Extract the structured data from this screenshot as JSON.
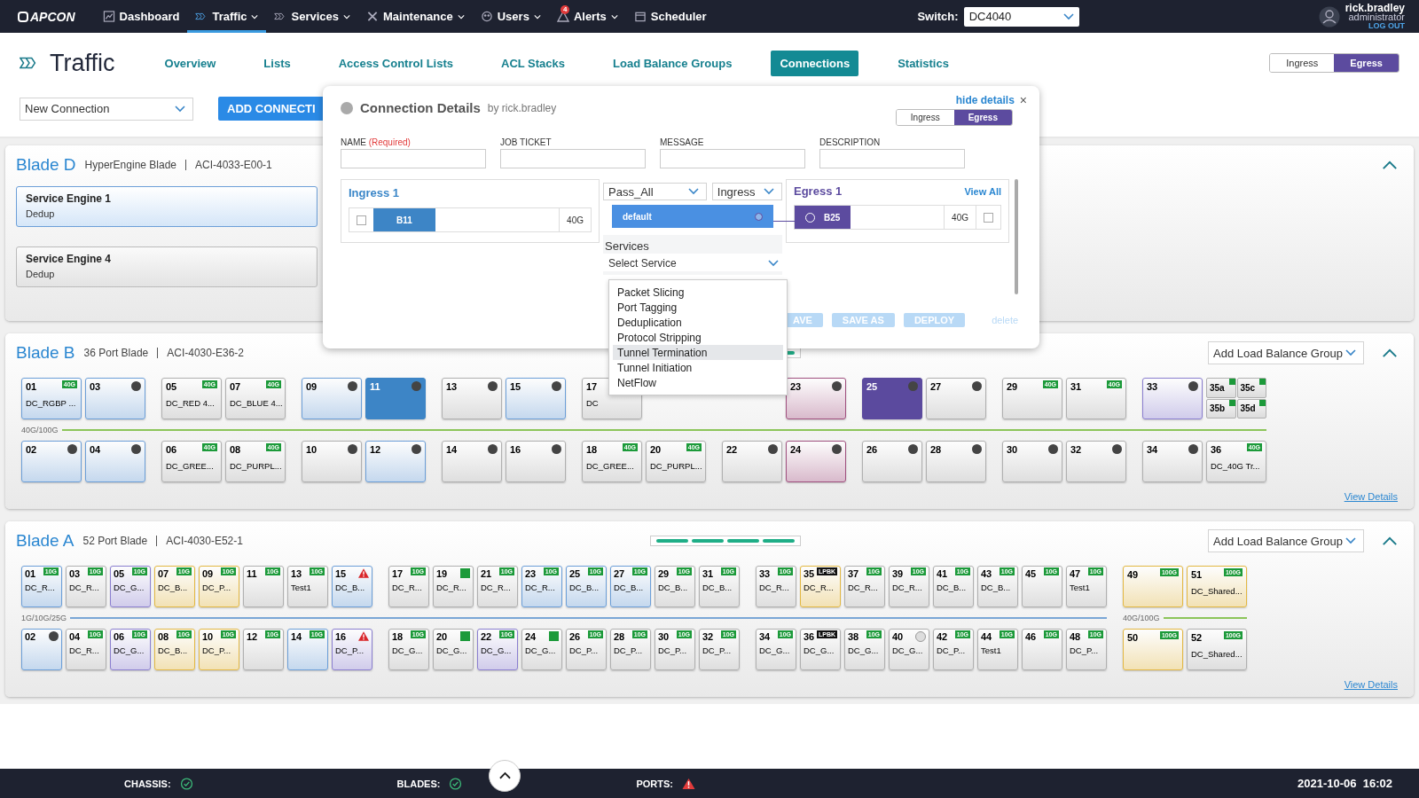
{
  "nav": {
    "logo": "APCON",
    "items": [
      {
        "label": "Dashboard",
        "selected": false,
        "caret": false
      },
      {
        "label": "Traffic",
        "selected": true,
        "caret": true
      },
      {
        "label": "Services",
        "selected": false,
        "caret": true
      },
      {
        "label": "Maintenance",
        "selected": false,
        "caret": true
      },
      {
        "label": "Users",
        "selected": false,
        "caret": true
      },
      {
        "label": "Alerts",
        "selected": false,
        "caret": true,
        "badge": "4"
      },
      {
        "label": "Scheduler",
        "selected": false,
        "caret": false
      }
    ],
    "switch": {
      "label": "Switch:",
      "value": "DC4040"
    },
    "user": {
      "name": "rick.bradley",
      "role": "administrator",
      "logout": "LOG OUT"
    }
  },
  "page": {
    "title": "Traffic",
    "tabs": [
      {
        "label": "Overview",
        "selected": false
      },
      {
        "label": "Lists",
        "selected": false
      },
      {
        "label": "Access Control Lists",
        "selected": false
      },
      {
        "label": "ACL Stacks",
        "selected": false
      },
      {
        "label": "Load Balance Groups",
        "selected": false
      },
      {
        "label": "Connections",
        "selected": true
      },
      {
        "label": "Statistics",
        "selected": false
      }
    ],
    "direction": [
      {
        "label": "Ingress",
        "selected": false
      },
      {
        "label": "Egress",
        "selected": true
      }
    ]
  },
  "toolbar": {
    "connection_select": "New Connection",
    "add_button": "ADD CONNECTI"
  },
  "blades": [
    {
      "kind": "engines",
      "name": "Blade D",
      "type": "HyperEngine Blade",
      "model": "ACI-4033-E00-1",
      "expanded": true,
      "engines": [
        {
          "name": "Service Engine 1",
          "service": "Dedup",
          "selected": true
        },
        {
          "name": "Service Engine 4",
          "service": "Dedup",
          "selected": false
        }
      ]
    },
    {
      "kind": "ports",
      "name": "Blade B",
      "type": "36 Port Blade",
      "model": "ACI-4030-E36-2",
      "expanded": true,
      "lb_select": "Add Load Balance Group",
      "view_details": "View Details",
      "groups": [
        {
          "speed": "40G/100G",
          "color": "#8cc55a",
          "top": [
            {
              "n": "01",
              "label": "DC_RGBP ...",
              "badge": "40G",
              "color": "#6c9fd8"
            },
            {
              "n": "03",
              "indicator": {
                "kind": "dot"
              },
              "color": "#6c9fd8"
            }
          ],
          "bottom": [
            {
              "n": "02",
              "indicator": {
                "kind": "dot"
              },
              "color": "#6c9fd8"
            },
            {
              "n": "04",
              "indicator": {
                "kind": "dot"
              },
              "color": "#6c9fd8"
            }
          ]
        },
        {
          "color": "#8cc55a",
          "top": [
            {
              "n": "05",
              "label": "DC_RED 4...",
              "badge": "40G",
              "color": "#b0b0b0"
            },
            {
              "n": "07",
              "label": "DC_BLUE 4...",
              "badge": "40G",
              "color": "#b0b0b0"
            }
          ],
          "bottom": [
            {
              "n": "06",
              "label": "DC_GREE...",
              "badge": "40G",
              "color": "#b0b0b0"
            },
            {
              "n": "08",
              "label": "DC_PURPL...",
              "badge": "40G",
              "color": "#b0b0b0"
            }
          ]
        },
        {
          "color": "#8cc55a",
          "top": [
            {
              "n": "09",
              "indicator": {
                "kind": "dot"
              },
              "color": "#6c9fd8"
            },
            {
              "n": "11",
              "kind": "filled",
              "indicator": {
                "kind": "dot"
              },
              "color": "#3d85c6"
            }
          ],
          "bottom": [
            {
              "n": "10",
              "indicator": {
                "kind": "dot"
              },
              "color": "#b0b0b0"
            },
            {
              "n": "12",
              "indicator": {
                "kind": "dot"
              },
              "color": "#6c9fd8"
            }
          ]
        },
        {
          "color": "#8cc55a",
          "top": [
            {
              "n": "13",
              "indicator": {
                "kind": "dot"
              },
              "color": "#b0b0b0"
            },
            {
              "n": "15",
              "indicator": {
                "kind": "dot"
              },
              "color": "#6c9fd8"
            }
          ],
          "bottom": [
            {
              "n": "14",
              "indicator": {
                "kind": "dot"
              },
              "color": "#b0b0b0"
            },
            {
              "n": "16",
              "indicator": {
                "kind": "dot"
              },
              "color": "#b0b0b0"
            }
          ]
        },
        {
          "color": "#8cc55a",
          "top": [
            {
              "n": "17",
              "label": "DC",
              "color": "#b0b0b0"
            },
            {
              "kind": "covered"
            }
          ],
          "bottom": [
            {
              "n": "18",
              "label": "DC_GREE...",
              "badge": "40G",
              "color": "#b0b0b0"
            },
            {
              "n": "20",
              "label": "DC_PURPL...",
              "badge": "40G",
              "color": "#b0b0b0"
            }
          ]
        },
        {
          "color": "#8cc55a",
          "top": [
            {
              "kind": "covered"
            },
            {
              "n": "23",
              "indicator": {
                "kind": "dot"
              },
              "color": "#a0507f"
            }
          ],
          "bottom": [
            {
              "n": "22",
              "indicator": {
                "kind": "dot"
              },
              "color": "#b0b0b0"
            },
            {
              "n": "24",
              "indicator": {
                "kind": "dot"
              },
              "color": "#a0507f"
            }
          ]
        },
        {
          "color": "#8cc55a",
          "top": [
            {
              "n": "25",
              "kind": "filled",
              "indicator": {
                "kind": "dot"
              },
              "color": "#5b4a9e"
            },
            {
              "n": "27",
              "indicator": {
                "kind": "dot"
              },
              "color": "#b0b0b0"
            }
          ],
          "bottom": [
            {
              "n": "26",
              "indicator": {
                "kind": "dot"
              },
              "color": "#b0b0b0"
            },
            {
              "n": "28",
              "indicator": {
                "kind": "dot"
              },
              "color": "#b0b0b0"
            }
          ]
        },
        {
          "color": "#8cc55a",
          "top": [
            {
              "n": "29",
              "badge": "40G",
              "color": "#b0b0b0"
            },
            {
              "n": "31",
              "badge": "40G",
              "color": "#b0b0b0"
            }
          ],
          "bottom": [
            {
              "n": "30",
              "indicator": {
                "kind": "dot"
              },
              "color": "#b0b0b0"
            },
            {
              "n": "32",
              "indicator": {
                "kind": "dot"
              },
              "color": "#b0b0b0"
            }
          ]
        },
        {
          "color": "#8cc55a",
          "top": [
            {
              "n": "33",
              "indicator": {
                "kind": "dot"
              },
              "color": "#8b7fd0"
            },
            {
              "kind": "split",
              "subports": [
                {
                  "n": "35a"
                },
                {
                  "n": "35c"
                },
                {
                  "n": "35b"
                },
                {
                  "n": "35d"
                }
              ]
            }
          ],
          "bottom": [
            {
              "n": "34",
              "indicator": {
                "kind": "dot"
              },
              "color": "#b0b0b0"
            },
            {
              "n": "36",
              "label": "DC_40G Tr...",
              "badge": "40G",
              "color": "#b0b0b0"
            }
          ]
        }
      ]
    },
    {
      "kind": "ports",
      "name": "Blade A",
      "type": "52 Port Blade",
      "model": "ACI-4030-E52-1",
      "expanded": true,
      "lb_select": "Add Load Balance Group",
      "view_details": "View Details",
      "groups": [
        {
          "speed": "1G/10G/25G",
          "color": "#7aa6d6",
          "top": [
            {
              "n": "01",
              "label": "DC_R...",
              "badge": "10G",
              "color": "#6c9fd8"
            },
            {
              "n": "03",
              "label": "DC_R...",
              "badge": "10G",
              "color": "#b0b0b0"
            },
            {
              "n": "05",
              "label": "DC_G...",
              "badge": "10G",
              "color": "#8b7fd0"
            },
            {
              "n": "07",
              "label": "DC_B...",
              "badge": "10G",
              "color": "#e3b843"
            },
            {
              "n": "09",
              "label": "DC_P...",
              "badge": "10G",
              "color": "#e3b843"
            },
            {
              "n": "11",
              "badge": "10G",
              "color": "#b0b0b0"
            },
            {
              "n": "13",
              "label": "Test1",
              "badge": "10G",
              "color": "#b0b0b0"
            },
            {
              "n": "15",
              "label": "DC_B...",
              "indicator": {
                "kind": "warning"
              },
              "color": "#6c9fd8"
            }
          ],
          "bottom": [
            {
              "n": "02",
              "indicator": {
                "kind": "dot"
              },
              "color": "#6c9fd8"
            },
            {
              "n": "04",
              "label": "DC_R...",
              "badge": "10G",
              "color": "#b0b0b0"
            },
            {
              "n": "06",
              "label": "DC_G...",
              "badge": "10G",
              "color": "#8b7fd0"
            },
            {
              "n": "08",
              "label": "DC_B...",
              "badge": "10G",
              "color": "#e3b843"
            },
            {
              "n": "10",
              "label": "DC_P...",
              "badge": "10G",
              "color": "#e3b843"
            },
            {
              "n": "12",
              "badge": "10G",
              "color": "#b0b0b0"
            },
            {
              "n": "14",
              "badge": "10G",
              "color": "#6c9fd8"
            },
            {
              "n": "16",
              "label": "DC_P...",
              "indicator": {
                "kind": "warning"
              },
              "color": "#8b7fd0"
            }
          ]
        },
        {
          "color": "#7aa6d6",
          "top": [
            {
              "n": "17",
              "label": "DC_R...",
              "badge": "10G",
              "color": "#b0b0b0"
            },
            {
              "n": "19",
              "label": "DC_R...",
              "indicator": {
                "kind": "square"
              },
              "color": "#b0b0b0"
            },
            {
              "n": "21",
              "label": "DC_R...",
              "badge": "10G",
              "color": "#b0b0b0"
            },
            {
              "n": "23",
              "label": "DC_R...",
              "badge": "10G",
              "color": "#6c9fd8"
            },
            {
              "n": "25",
              "label": "DC_B...",
              "badge": "10G",
              "color": "#6c9fd8"
            },
            {
              "n": "27",
              "label": "DC_B...",
              "badge": "10G",
              "color": "#6c9fd8"
            },
            {
              "n": "29",
              "label": "DC_B...",
              "badge": "10G",
              "color": "#b0b0b0"
            },
            {
              "n": "31",
              "label": "DC_B...",
              "badge": "10G",
              "color": "#b0b0b0"
            }
          ],
          "bottom": [
            {
              "n": "18",
              "label": "DC_G...",
              "badge": "10G",
              "color": "#b0b0b0"
            },
            {
              "n": "20",
              "label": "DC_G...",
              "indicator": {
                "kind": "square"
              },
              "color": "#b0b0b0"
            },
            {
              "n": "22",
              "label": "DC_G...",
              "badge": "10G",
              "color": "#8b7fd0"
            },
            {
              "n": "24",
              "label": "DC_G...",
              "indicator": {
                "kind": "square"
              },
              "color": "#b0b0b0"
            },
            {
              "n": "26",
              "label": "DC_P...",
              "badge": "10G",
              "color": "#b0b0b0"
            },
            {
              "n": "28",
              "label": "DC_P...",
              "badge": "10G",
              "color": "#b0b0b0"
            },
            {
              "n": "30",
              "label": "DC_P...",
              "badge": "10G",
              "color": "#b0b0b0"
            },
            {
              "n": "32",
              "label": "DC_P...",
              "badge": "10G",
              "color": "#b0b0b0"
            }
          ]
        },
        {
          "color": "#7aa6d6",
          "top": [
            {
              "n": "33",
              "label": "DC_R...",
              "badge": "10G",
              "color": "#b0b0b0"
            },
            {
              "n": "35",
              "label": "DC_R...",
              "badge": {
                "label": "LPBK",
                "kind": "loopback"
              },
              "color": "#e3b843"
            },
            {
              "n": "37",
              "label": "DC_R...",
              "badge": "10G",
              "color": "#b0b0b0"
            },
            {
              "n": "39",
              "label": "DC_R...",
              "badge": "10G",
              "color": "#b0b0b0"
            },
            {
              "n": "41",
              "label": "DC_B...",
              "badge": "10G",
              "color": "#b0b0b0"
            },
            {
              "n": "43",
              "label": "DC_B...",
              "badge": "10G",
              "color": "#b0b0b0"
            },
            {
              "n": "45",
              "badge": "10G",
              "color": "#b0b0b0"
            },
            {
              "n": "47",
              "label": "Test1",
              "badge": "10G",
              "color": "#b0b0b0"
            }
          ],
          "bottom": [
            {
              "n": "34",
              "label": "DC_G...",
              "badge": "10G",
              "color": "#b0b0b0"
            },
            {
              "n": "36",
              "label": "DC_G...",
              "badge": {
                "label": "LPBK",
                "kind": "loopback"
              },
              "color": "#b0b0b0"
            },
            {
              "n": "38",
              "label": "DC_G...",
              "badge": "10G",
              "color": "#b0b0b0"
            },
            {
              "n": "40",
              "label": "DC_G...",
              "indicator": {
                "kind": "ring"
              },
              "color": "#b0b0b0"
            },
            {
              "n": "42",
              "label": "DC_P...",
              "badge": "10G",
              "color": "#b0b0b0"
            },
            {
              "n": "44",
              "label": "Test1",
              "badge": "10G",
              "color": "#b0b0b0"
            },
            {
              "n": "46",
              "badge": "10G",
              "color": "#b0b0b0"
            },
            {
              "n": "48",
              "label": "DC_P...",
              "badge": "10G",
              "color": "#b0b0b0"
            }
          ]
        },
        {
          "speed": "40G/100G",
          "color": "#8cc55a",
          "top": [
            {
              "n": "49",
              "badge": "100G",
              "color": "#e3b843"
            },
            {
              "n": "51",
              "label": "DC_Shared...",
              "badge": "100G",
              "color": "#e3b843"
            }
          ],
          "bottom": [
            {
              "n": "50",
              "badge": "100G",
              "color": "#e3b843"
            },
            {
              "n": "52",
              "label": "DC_Shared...",
              "badge": "100G",
              "color": "#b0b0b0"
            }
          ]
        }
      ]
    }
  ],
  "modal": {
    "title": "Connection Details",
    "author": "by rick.bradley",
    "hide": "hide details",
    "close": "×",
    "direction": [
      {
        "label": "Ingress",
        "selected": false
      },
      {
        "label": "Egress",
        "selected": true
      }
    ],
    "fields": [
      {
        "label": "NAME",
        "note": "(Required)"
      },
      {
        "label": "JOB TICKET"
      },
      {
        "label": "MESSAGE"
      },
      {
        "label": "DESCRIPTION"
      }
    ],
    "ingress": {
      "title": "Ingress 1",
      "port": "B11",
      "speed": "40G",
      "checked": false
    },
    "filter": "Pass_All",
    "filter_direction": "Ingress",
    "map": "default",
    "egress": {
      "title": "Egress 1",
      "view_all": "View All",
      "port": "B25",
      "speed": "40G",
      "checked": false
    },
    "services": {
      "title": "Services",
      "placeholder": "Select Service",
      "options": [
        {
          "label": "Packet Slicing",
          "selected": false
        },
        {
          "label": "Port Tagging",
          "selected": false
        },
        {
          "label": "Deduplication",
          "selected": false
        },
        {
          "label": "Protocol Stripping",
          "selected": false
        },
        {
          "label": "Tunnel Termination",
          "selected": true
        },
        {
          "label": "Tunnel Initiation",
          "selected": false
        },
        {
          "label": "NetFlow",
          "selected": false
        }
      ]
    },
    "buttons": [
      {
        "label": "AVE",
        "disabled": true
      },
      {
        "label": "SAVE AS",
        "disabled": true
      },
      {
        "label": "DEPLOY",
        "disabled": true
      }
    ],
    "delete": {
      "label": "delete",
      "disabled": true
    }
  },
  "status_bar": {
    "items": [
      {
        "label": "CHASSIS:",
        "kind": "ok"
      },
      {
        "label": "BLADES:",
        "kind": "ok"
      },
      {
        "label": "PORTS:",
        "kind": "warning"
      }
    ],
    "datetime": "2021-10-06  16:02"
  }
}
